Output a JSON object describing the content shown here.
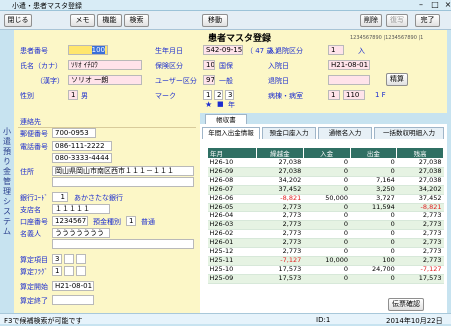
{
  "window": {
    "title": "小遣・患者マスタ登録"
  },
  "toolbar": {
    "close": "閉じる",
    "memo": "メモ",
    "function": "機能",
    "search": "検索",
    "move": "移動",
    "delete": "削除",
    "undo": "復写",
    "done": "完了"
  },
  "page_title": "患者マスタ登録",
  "header": {
    "patient_no_label": "患者番号",
    "patient_no": "100",
    "name_kana_label": "氏名（カナ）",
    "name_kana": "ｿﾘｵ ｲﾁﾛｳ",
    "kanji_label": "（漢字）",
    "name_kanji": "ソリオ 一朗",
    "sex_label": "性別",
    "sex_code": "1",
    "sex_text": "男",
    "birth_label": "生年月日",
    "birth": "S42-09-15",
    "age": "（ 47 歳 ）",
    "insurance_label": "保険区分",
    "insurance_code": "10",
    "insurance_text": "国保",
    "user_class_label": "ユーザー区分",
    "user_class_code": "97",
    "user_class_text": "一般",
    "mark_label": "マーク",
    "marks": [
      "1",
      "2",
      "3"
    ],
    "mark_star": "★",
    "mark_square": "■",
    "mark_year": "年",
    "admission_class_label": "入退院区分",
    "admission_class_code": "1",
    "admission_class_text": "入",
    "admission_date_label": "入院日",
    "admission_date": "H21-08-01",
    "discharge_date_label": "退院日",
    "settle_button": "精算",
    "ward_label": "病棟・病室",
    "ward": "1",
    "room": "110",
    "floor": "1 F",
    "ruler_text": "1234567890 |1234567890 |1"
  },
  "sidebar_text": "小遣預り金管理システム",
  "left": {
    "contact_label": "連絡先",
    "postal_label": "郵便番号",
    "postal": "700-0953",
    "phone_label": "電話番号",
    "phone1": "086-111-2222",
    "phone2": "080-3333-4444",
    "address_label": "住所",
    "address": "岡山県岡山市南区西市１１１－１１１",
    "bank_code_label": "銀行ｺｰﾄﾞ",
    "bank_code": "1",
    "bank_name": "あかさたな銀行",
    "branch_label": "支店名",
    "branch": "１１１１１",
    "account_label": "口座番号",
    "account_no": "1234567",
    "deposit_type_label": "預金種別",
    "deposit_type_code": "1",
    "deposit_type": "普通",
    "holder_label": "名義人",
    "holder": "ううううううう",
    "calc_item_label": "算定項目",
    "calc_item": "3",
    "calc_flag_label": "算定ﾌﾗｸﾞ",
    "calc_flag": "1",
    "calc_start_label": "算定開始",
    "calc_start": "H21-08-01",
    "calc_end_label": "算定終了",
    "calc_end": ""
  },
  "right": {
    "section_label": "帳収書",
    "tabs": [
      "年間入出金情報",
      "預金口座入力",
      "通帳名入力",
      "一括数収明細入力"
    ],
    "table": {
      "headers": [
        "年月",
        "繰越金",
        "入金",
        "出金",
        "残高"
      ],
      "rows": [
        [
          "H26-10",
          "27,038",
          "0",
          "0",
          "27,038"
        ],
        [
          "H26-09",
          "27,038",
          "0",
          "0",
          "27,038"
        ],
        [
          "H26-08",
          "34,202",
          "0",
          "7,164",
          "27,038"
        ],
        [
          "H26-07",
          "37,452",
          "0",
          "3,250",
          "34,202"
        ],
        [
          "H26-06",
          "-8,821",
          "50,000",
          "3,727",
          "37,452"
        ],
        [
          "H26-05",
          "2,773",
          "0",
          "11,594",
          "-8,821"
        ],
        [
          "H26-04",
          "2,773",
          "0",
          "0",
          "2,773"
        ],
        [
          "H26-03",
          "2,773",
          "0",
          "0",
          "2,773"
        ],
        [
          "H26-02",
          "2,773",
          "0",
          "0",
          "2,773"
        ],
        [
          "H26-01",
          "2,773",
          "0",
          "0",
          "2,773"
        ],
        [
          "H25-12",
          "2,773",
          "0",
          "0",
          "2,773"
        ],
        [
          "H25-11",
          "-7,127",
          "10,000",
          "100",
          "2,773"
        ],
        [
          "H25-10",
          "17,573",
          "0",
          "24,700",
          "-7,127"
        ],
        [
          "H25-09",
          "17,573",
          "0",
          "0",
          "17,573"
        ]
      ]
    },
    "confirm_button": "伝票確認"
  },
  "status": {
    "message": "F3で候補検索が可能です",
    "id": "ID:1",
    "date": "2014年10月22日"
  }
}
